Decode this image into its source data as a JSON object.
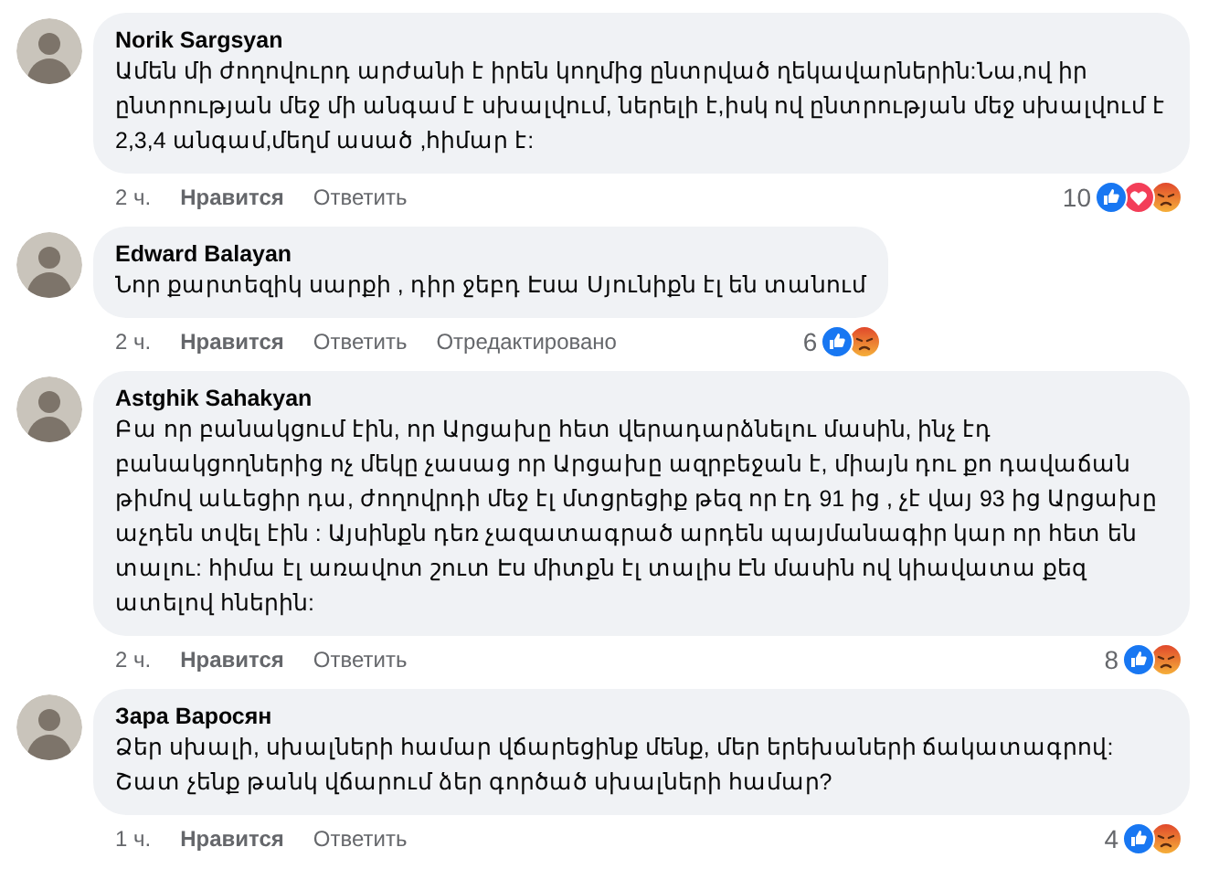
{
  "comments": [
    {
      "author": "Norik Sargsyan",
      "text": "Ամեն մի ժողովուրդ արժանի է իրեն կողմից ընտրված ղեկավարներին:Նա,ով իր ընտրության մեջ մի անգամ է սխալվում, ներելի է,իսկ ով ընտրության մեջ սխալվում է 2,3,4 անգամ,մեղմ ասած ,հիմար է:",
      "time": "2 ч.",
      "like": "Нравится",
      "reply": "Ответить",
      "reaction_count": "10",
      "reactions": [
        {
          "kind": "like"
        },
        {
          "kind": "love"
        },
        {
          "kind": "angry"
        }
      ]
    },
    {
      "author": "Edward Balayan",
      "text": "Նոր քարտեզիկ սարքի , դիր ջեբդ Էսա Սյունիքն էլ են տանում",
      "time": "2 ч.",
      "like": "Нравится",
      "reply": "Ответить",
      "edited": "Отредактировано",
      "reaction_count": "6",
      "reactions": [
        {
          "kind": "like"
        },
        {
          "kind": "angry"
        }
      ]
    },
    {
      "author": "Astghik Sahakyan",
      "text": "Բա որ բանակցում էին, որ Արցախը հետ վերադարձնելու մասին, ինչ էդ բանակցողներից ոչ մեկը չասաց որ Արցախը ազրբեջան է, միայն դու քո դավաճան թիմով աևեցիր դա, ժողովրդի մեջ էլ մտցրեցիք թեզ որ էդ 91 ից , չէ վայ 93 ից Արցախը աչդեն տվել էին : Այսինքն դեռ չազատագրած արդեն պայմանագիր կար որ հետ են տալու: հիմա էլ առավոտ շուտ Էս միտքն էլ տալիս Էն մասին ով կիավատա քեզ ատելով հներին:",
      "time": "2 ч.",
      "like": "Нравится",
      "reply": "Ответить",
      "reaction_count": "8",
      "reactions": [
        {
          "kind": "like"
        },
        {
          "kind": "angry"
        }
      ]
    },
    {
      "author": "Зара Варосян",
      "text": "Ձեր սխալի, սխալների համար վճարեցինք մենք, մեր երեխաների ճակատագրով: Շատ չենք թանկ վճարում ձեր գործած սխալների համար?",
      "time": "1 ч.",
      "like": "Нравится",
      "reply": "Ответить",
      "reaction_count": "4",
      "reactions": [
        {
          "kind": "like"
        },
        {
          "kind": "angry"
        }
      ]
    }
  ]
}
